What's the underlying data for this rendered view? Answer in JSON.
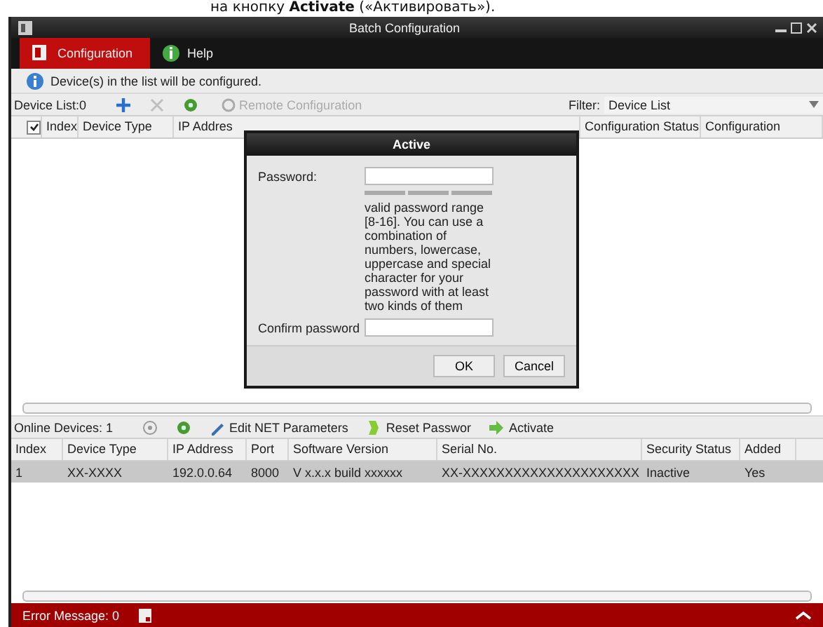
{
  "caption": "на кнопку **Activate** («Активировать»).",
  "window": {
    "title": "Batch Configuration"
  },
  "tabs": [
    {
      "label": "Configuration",
      "selected": true,
      "kind": "config"
    },
    {
      "label": "Help",
      "selected": false,
      "kind": "help"
    }
  ],
  "info": "Device(s) in the list will be configured.",
  "device_list": {
    "label": "Device List:0",
    "tools": [
      {
        "kind": "add",
        "disabled": false
      },
      {
        "kind": "delete",
        "disabled": true
      },
      {
        "kind": "refresh",
        "disabled": false
      }
    ],
    "remote_configuration": {
      "label": "Remote Configuration",
      "disabled": true
    },
    "filter_label": "Filter:",
    "filter_value": "Device List",
    "select_all": {
      "checked": true
    },
    "columns": [
      "Index",
      "Device Type",
      "IP Addres",
      "Configuration Status",
      "Configuration"
    ]
  },
  "dialog": {
    "title": "Active",
    "password_label": "Password:",
    "hint": "valid password range [8-16]. You can use a combination of numbers, lowercase, uppercase and special character for your password with at least two kinds of them",
    "confirm_label": "Confirm password",
    "buttons": [
      "OK",
      "Cancel"
    ]
  },
  "online": {
    "label": "Online Devices: 1",
    "tools": [
      {
        "kind": "scan"
      },
      {
        "kind": "refresh"
      },
      {
        "kind": "edit",
        "label": "Edit NET Parameters"
      },
      {
        "kind": "reset",
        "label": "Reset Passwor"
      },
      {
        "kind": "activate",
        "label": "Activate"
      }
    ],
    "columns": [
      "Index",
      "Device Type",
      "IP Address",
      "Port",
      "Software Version",
      "Serial No.",
      "Security Status",
      "Added"
    ],
    "rows": [
      {
        "cells": [
          "1",
          "XX-XXXX",
          "192.0.0.64",
          "8000",
          "V x.x.x build xxxxxx",
          "XX-XXXXXXXXXXXXXXXXXXXXX",
          "Inactive",
          "Yes"
        ],
        "selected": true
      }
    ]
  },
  "status_bar": {
    "error": "Error Message: 0"
  }
}
